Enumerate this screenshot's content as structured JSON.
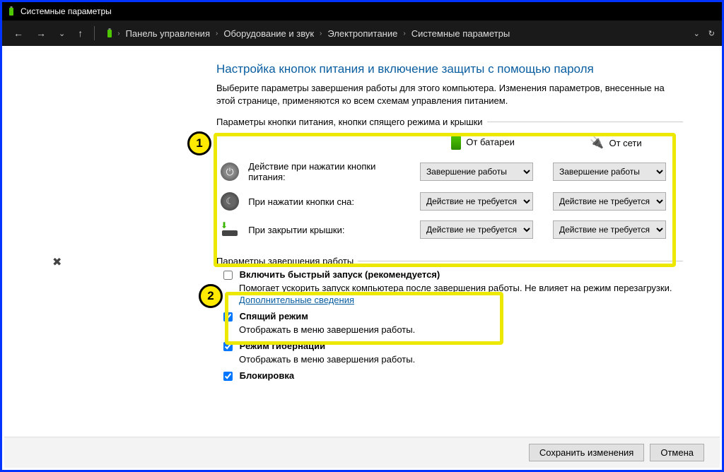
{
  "window": {
    "title": "Системные параметры"
  },
  "breadcrumb": [
    "Панель управления",
    "Оборудование и звук",
    "Электропитание",
    "Системные параметры"
  ],
  "heading": "Настройка кнопок питания и включение защиты с помощью пароля",
  "subtext": "Выберите параметры завершения работы для этого компьютера. Изменения параметров, внесенные на этой странице, применяются ко всем схемам управления питанием.",
  "legend1": "Параметры кнопки питания, кнопки спящего режима и крышки",
  "cols": {
    "battery": "От батареи",
    "plugged": "От сети"
  },
  "rows": [
    {
      "label": "Действие при нажатии кнопки питания:",
      "battery": "Завершение работы",
      "plugged": "Завершение работы"
    },
    {
      "label": "При нажатии кнопки сна:",
      "battery": "Действие не требуется",
      "plugged": "Действие не требуется"
    },
    {
      "label": "При закрытии крышки:",
      "battery": "Действие не требуется",
      "plugged": "Действие не требуется"
    }
  ],
  "legend2": "Параметры завершения работы",
  "faststart": {
    "label": "Включить быстрый запуск (рекомендуется)",
    "desc1": "Помогает ускорить запуск компьютера после завершения работы. Не влияет на режим перезагрузки. ",
    "link": "Дополнительные сведения"
  },
  "shutdownOpts": {
    "sleep": {
      "label": "Спящий режим",
      "desc": "Отображать в меню завершения работы."
    },
    "hiber": {
      "label": "Режим гибернации",
      "desc": "Отображать в меню завершения работы."
    },
    "lock": {
      "label": "Блокировка"
    }
  },
  "footer": {
    "save": "Сохранить изменения",
    "cancel": "Отмена"
  },
  "annot": {
    "b1": "1",
    "b2": "2"
  }
}
